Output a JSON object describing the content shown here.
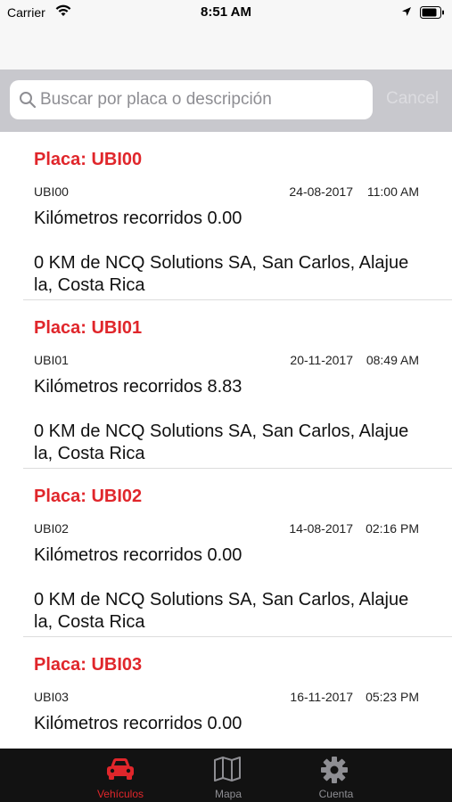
{
  "status_bar": {
    "carrier": "Carrier",
    "time": "8:51 AM"
  },
  "search": {
    "placeholder": "Buscar por placa o descripción",
    "cancel_label": "Cancel"
  },
  "vehicles": [
    {
      "placa": "Placa: UBI00",
      "code": "UBI00",
      "date": "24-08-2017",
      "time": "11:00 AM",
      "km": "Kilómetros recorridos 0.00",
      "address_line1": "0 KM de NCQ Solutions SA, San Carlos, Alajue",
      "address_line2": "la, Costa Rica"
    },
    {
      "placa": "Placa: UBI01",
      "code": "UBI01",
      "date": "20-11-2017",
      "time": "08:49 AM",
      "km": "Kilómetros recorridos 8.83",
      "address_line1": "0 KM de NCQ Solutions SA, San Carlos, Alajue",
      "address_line2": "la, Costa Rica"
    },
    {
      "placa": "Placa: UBI02",
      "code": "UBI02",
      "date": "14-08-2017",
      "time": "02:16 PM",
      "km": "Kilómetros recorridos 0.00",
      "address_line1": "0 KM de NCQ Solutions SA, San Carlos, Alajue",
      "address_line2": "la, Costa Rica"
    },
    {
      "placa": "Placa: UBI03",
      "code": "UBI03",
      "date": "16-11-2017",
      "time": "05:23 PM",
      "km": "Kilómetros recorridos 0.00"
    }
  ],
  "tabs": [
    {
      "label": "Vehículos",
      "icon": "car-icon",
      "active": true
    },
    {
      "label": "Mapa",
      "icon": "map-icon",
      "active": false
    },
    {
      "label": "Cuenta",
      "icon": "gear-icon",
      "active": false
    }
  ],
  "colors": {
    "accent": "#e0262b",
    "tab_bar": "#121212",
    "search_bar": "#c8c8cd"
  }
}
